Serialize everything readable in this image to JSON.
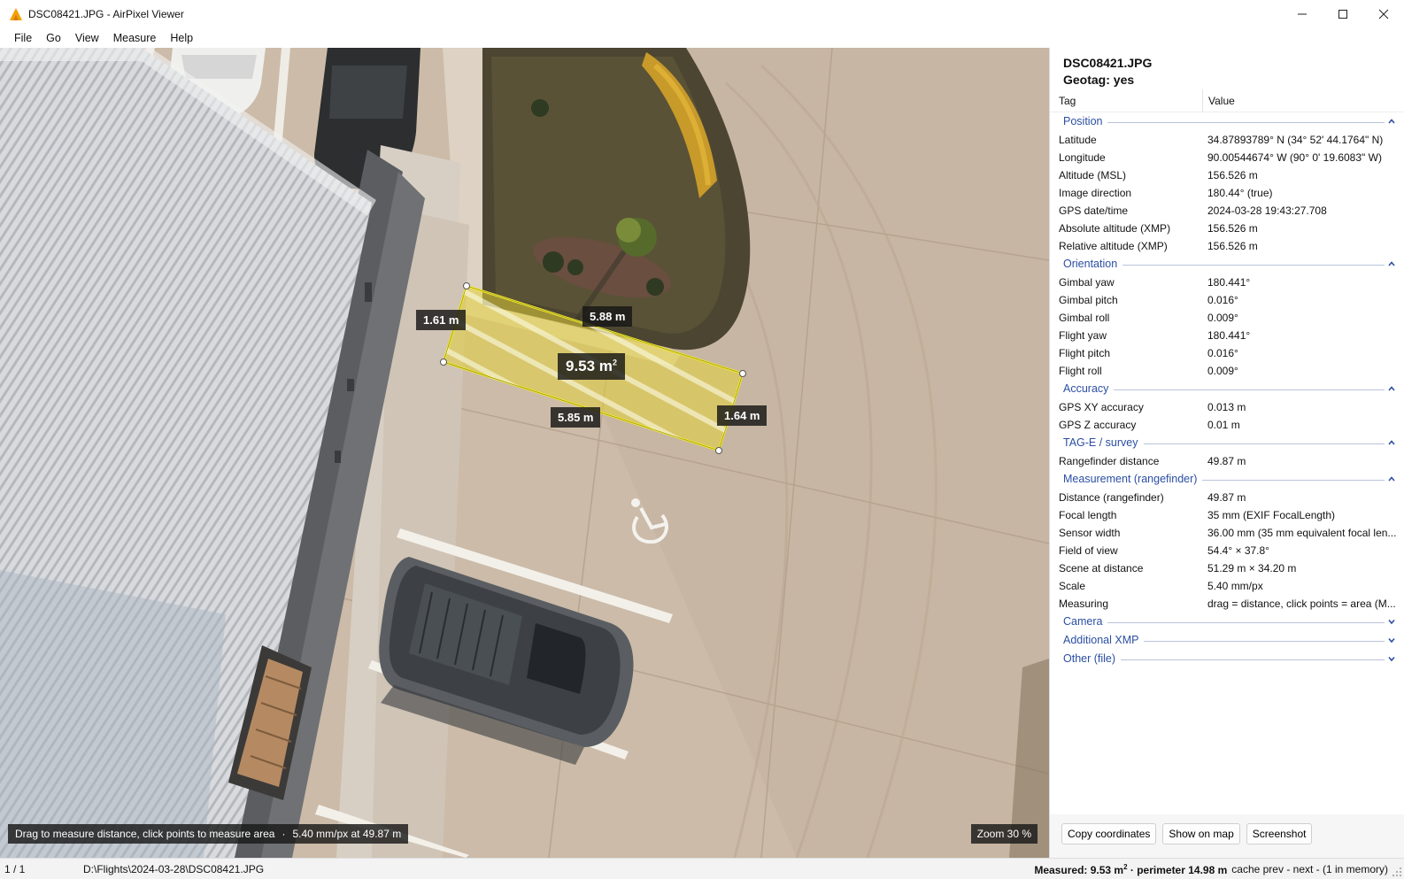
{
  "window": {
    "title": "DSC08421.JPG - AirPixel Viewer"
  },
  "menu": [
    {
      "label": "File"
    },
    {
      "label": "Go"
    },
    {
      "label": "View"
    },
    {
      "label": "Measure"
    },
    {
      "label": "Help"
    }
  ],
  "viewer": {
    "measurement": {
      "area_label": "9.53 m",
      "area_unit_sup": "2",
      "edges": [
        "1.61 m",
        "5.88 m",
        "5.85 m",
        "1.64 m"
      ]
    },
    "hint": {
      "text": "Drag to measure distance, click points to measure area",
      "scale": "5.40 mm/px at 49.87 m"
    },
    "zoom": "Zoom 30 %"
  },
  "panel": {
    "file_name": "DSC08421.JPG",
    "geotag": "Geotag: yes",
    "columns": {
      "tag": "Tag",
      "value": "Value"
    },
    "groups": [
      {
        "name": "Position",
        "expanded": true,
        "rows": [
          {
            "tag": "Latitude",
            "value": "34.87893789° N   (34° 52' 44.1764\" N)"
          },
          {
            "tag": "Longitude",
            "value": "90.00544674° W   (90° 0' 19.6083\" W)"
          },
          {
            "tag": "Altitude (MSL)",
            "value": "156.526 m"
          },
          {
            "tag": "Image direction",
            "value": "180.44° (true)"
          },
          {
            "tag": "GPS date/time",
            "value": "2024-03-28 19:43:27.708"
          },
          {
            "tag": "Absolute altitude (XMP)",
            "value": "156.526 m"
          },
          {
            "tag": "Relative altitude (XMP)",
            "value": "156.526 m"
          }
        ]
      },
      {
        "name": "Orientation",
        "expanded": true,
        "rows": [
          {
            "tag": "Gimbal yaw",
            "value": "180.441°"
          },
          {
            "tag": "Gimbal pitch",
            "value": "0.016°"
          },
          {
            "tag": "Gimbal roll",
            "value": "0.009°"
          },
          {
            "tag": "Flight yaw",
            "value": "180.441°"
          },
          {
            "tag": "Flight pitch",
            "value": "0.016°"
          },
          {
            "tag": "Flight roll",
            "value": "0.009°"
          }
        ]
      },
      {
        "name": "Accuracy",
        "expanded": true,
        "rows": [
          {
            "tag": "GPS XY accuracy",
            "value": "0.013 m"
          },
          {
            "tag": "GPS Z accuracy",
            "value": "0.01 m"
          }
        ]
      },
      {
        "name": "TAG-E / survey",
        "expanded": true,
        "rows": [
          {
            "tag": "Rangefinder distance",
            "value": "49.87 m"
          }
        ]
      },
      {
        "name": "Measurement (rangefinder)",
        "expanded": true,
        "rows": [
          {
            "tag": "Distance (rangefinder)",
            "value": "49.87 m"
          },
          {
            "tag": "Focal length",
            "value": "35 mm (EXIF FocalLength)"
          },
          {
            "tag": "Sensor width",
            "value": "36.00 mm (35 mm equivalent focal len..."
          },
          {
            "tag": "Field of view",
            "value": "54.4° × 37.8°"
          },
          {
            "tag": "Scene at distance",
            "value": "51.29 m × 34.20 m"
          },
          {
            "tag": "Scale",
            "value": "5.40 mm/px"
          },
          {
            "tag": "Measuring",
            "value": "drag = distance, click points = area (M..."
          }
        ]
      },
      {
        "name": "Camera",
        "expanded": false,
        "rows": []
      },
      {
        "name": "Additional XMP",
        "expanded": false,
        "rows": []
      },
      {
        "name": "Other (file)",
        "expanded": false,
        "rows": []
      }
    ],
    "buttons": {
      "copy": "Copy coordinates",
      "map": "Show on map",
      "screenshot": "Screenshot"
    }
  },
  "status": {
    "count": "1 / 1",
    "path": "D:\\Flights\\2024-03-28\\DSC08421.JPG",
    "measured": "Measured: 9.53 m",
    "measured_sup": "2",
    "perimeter": " · perimeter 14.98 m",
    "cache": "cache  prev -  next -  (1 in memory)"
  },
  "colors": {
    "accent": "#2b4ea2",
    "measure_fill": "#e4d23a",
    "measure_stroke": "#f2ea2a"
  }
}
